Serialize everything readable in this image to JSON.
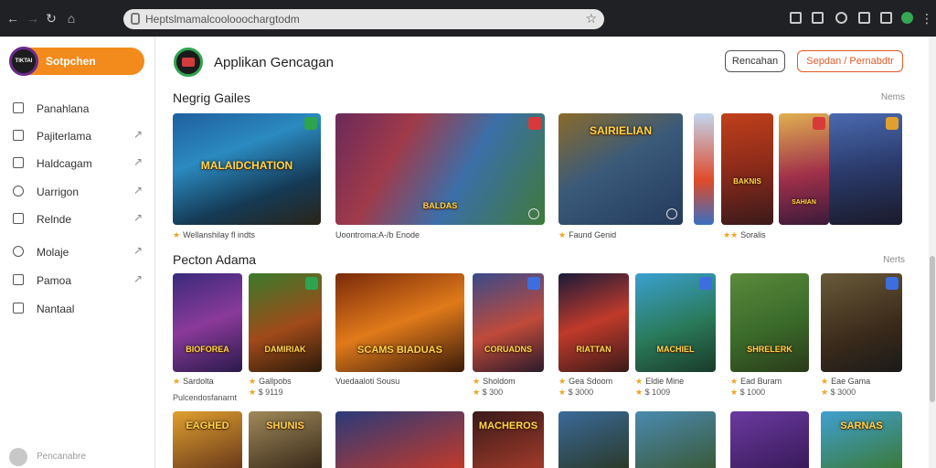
{
  "browser": {
    "url": "Heptslmamalcoolooochargtodm",
    "back_icon": "arrow-left-icon",
    "forward_icon": "arrow-right-icon",
    "reload_icon": "reload-icon",
    "home_icon": "home-icon"
  },
  "sidebar": {
    "brand_logo_text": "TIKTAI",
    "brand_label": "Sotpchen",
    "items": [
      {
        "label": "Panahlana",
        "icon": "list-icon",
        "chevron": false
      },
      {
        "label": "Pajiterlama",
        "icon": "home-icon",
        "chevron": true
      },
      {
        "label": "Haldcagam",
        "icon": "document-icon",
        "chevron": true
      },
      {
        "label": "Uarrigon",
        "icon": "tag-icon",
        "chevron": true
      },
      {
        "label": "Relnde",
        "icon": "calendar-icon",
        "chevron": true
      },
      {
        "label": "Molaje",
        "icon": "gamepad-icon",
        "chevron": true
      },
      {
        "label": "Pamoa",
        "icon": "notes-icon",
        "chevron": true
      },
      {
        "label": "Nantaal",
        "icon": "table-icon",
        "chevron": false
      }
    ],
    "footer_label": "Pencanabre"
  },
  "header": {
    "title": "Applikan Gencagan",
    "button_outline": "Rencahan",
    "button_accent": "Sepdan / Pernabdtr"
  },
  "sections": [
    {
      "title": "Negrig Gailes",
      "more": "Nems"
    },
    {
      "title": "Pecton Adama",
      "more": "Nerts"
    }
  ],
  "featured": [
    {
      "title": "MALAIDCHATION",
      "meta": "Wellanshilay fl indts",
      "rating_star": true,
      "badge": "green"
    },
    {
      "title": "BALDAS",
      "meta": "Uoontroma:A-/b Enode",
      "rating_star": false,
      "badge": "red"
    },
    {
      "title": "SAIRIELIAN",
      "meta": "Faund Genid",
      "rating_star": true,
      "badge": ""
    },
    {
      "title": "",
      "meta": "",
      "rating_star": false,
      "badge": ""
    },
    {
      "title": "BAKNIS",
      "meta": "",
      "rating_star": false,
      "badge": ""
    },
    {
      "title": "SAHIAN",
      "meta": "",
      "rating_star": false,
      "badge": "red"
    },
    {
      "title": "",
      "meta": "Soralis",
      "rating_star": true,
      "badge": ""
    }
  ],
  "grid_row1": [
    {
      "title": "BIOFOREA",
      "name": "Sardolta",
      "sub": "",
      "badge": ""
    },
    {
      "title": "DAMIRIAK",
      "name": "Gallpobs",
      "sub": "$ 9119",
      "badge": "green"
    },
    {
      "title": "SCAMS BIADUAS",
      "name": "Vuedaaloti Sousu",
      "sub": "",
      "badge": ""
    },
    {
      "title": "CORUADNS",
      "name": "Sholdom",
      "sub": "$ 300",
      "badge": "blue"
    },
    {
      "title": "RIATTAN",
      "name": "Gea Sdoom",
      "sub": "$ 3000",
      "badge": ""
    },
    {
      "title": "MACHIEL",
      "name": "Eldie Mine",
      "sub": "$ 1009",
      "badge": "blue"
    },
    {
      "title": "SHRELERK",
      "name": "Ead Buram",
      "sub": "$ 1000",
      "badge": ""
    },
    {
      "title": "",
      "name": "Eae Gama",
      "sub": "$ 3000",
      "badge": "blue"
    }
  ],
  "grid_row1_note": "Pulcendosfanarnt",
  "grid_row2": [
    {
      "title": "EAGHED",
      "badge": ""
    },
    {
      "title": "SHUNIS",
      "badge": ""
    },
    {
      "title": "",
      "badge": ""
    },
    {
      "title": "MACHEROS",
      "badge": ""
    },
    {
      "title": "",
      "badge": ""
    },
    {
      "title": "",
      "badge": ""
    },
    {
      "title": "",
      "badge": ""
    },
    {
      "title": "SARNAS",
      "badge": ""
    }
  ],
  "colors": {
    "accent": "#f38a1c",
    "accent_outline": "#e05a2a",
    "chrome": "#202124",
    "star": "#f1a31c"
  }
}
